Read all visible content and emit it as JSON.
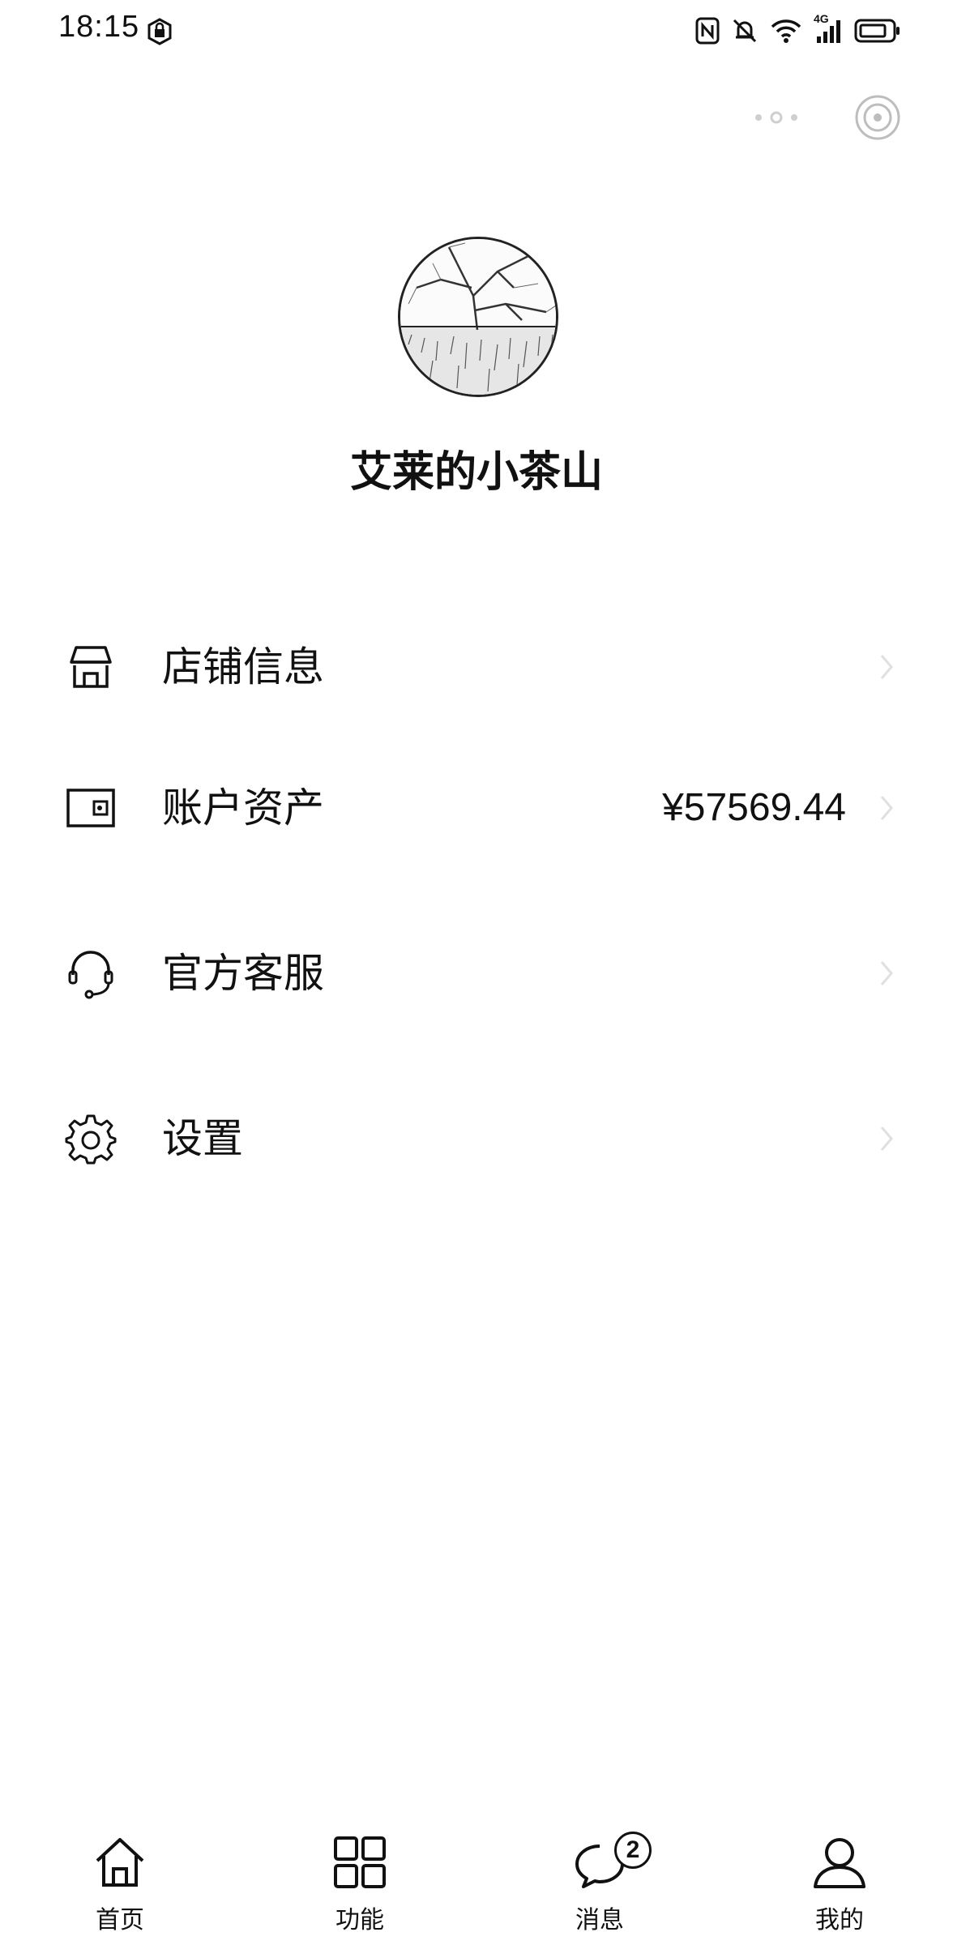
{
  "status_bar": {
    "time": "18:15",
    "network": "4G"
  },
  "top_actions": {
    "more_icon": "more-dots-icon",
    "scan_icon": "scan-target-icon"
  },
  "profile": {
    "shop_name": "艾莱的小茶山"
  },
  "menu": {
    "items": [
      {
        "label": "店铺信息",
        "value": "",
        "icon": "store-icon"
      },
      {
        "label": "账户资产",
        "value": "¥57569.44",
        "icon": "wallet-icon"
      },
      {
        "label": "官方客服",
        "value": "",
        "icon": "headset-icon"
      },
      {
        "label": "设置",
        "value": "",
        "icon": "gear-icon"
      }
    ]
  },
  "bottom_nav": {
    "items": [
      {
        "label": "首页",
        "icon": "home-icon"
      },
      {
        "label": "功能",
        "icon": "grid-icon"
      },
      {
        "label": "消息",
        "icon": "chat-icon",
        "badge": "2"
      },
      {
        "label": "我的",
        "icon": "user-icon"
      }
    ]
  }
}
